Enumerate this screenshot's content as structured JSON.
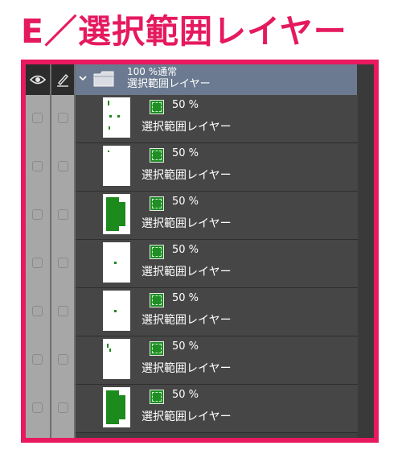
{
  "heading": "E／選択範囲レイヤー",
  "colors": {
    "accent": "#e8195f",
    "header": "#6b7a90",
    "panel": "#404040",
    "layer_icon": "#1f8e24"
  },
  "header": {
    "eye_icon": "eye-icon",
    "pen_icon": "pen-icon",
    "expand_icon": "chevron-down-icon",
    "folder_icon": "folder-icon",
    "blend_label": "100 %通常",
    "folder_name": "選択範囲レイヤー"
  },
  "layers": [
    {
      "opacity": "50 %",
      "name": "選択範囲レイヤー",
      "thumb": "sparse-marks"
    },
    {
      "opacity": "50 %",
      "name": "選択範囲レイヤー",
      "thumb": "blank"
    },
    {
      "opacity": "50 %",
      "name": "選択範囲レイヤー",
      "thumb": "large-shape"
    },
    {
      "opacity": "50 %",
      "name": "選択範囲レイヤー",
      "thumb": "small-mark"
    },
    {
      "opacity": "50 %",
      "name": "選択範囲レイヤー",
      "thumb": "small-mark"
    },
    {
      "opacity": "50 %",
      "name": "選択範囲レイヤー",
      "thumb": "corner-mark"
    },
    {
      "opacity": "50 %",
      "name": "選択範囲レイヤー",
      "thumb": "large-shape"
    }
  ]
}
